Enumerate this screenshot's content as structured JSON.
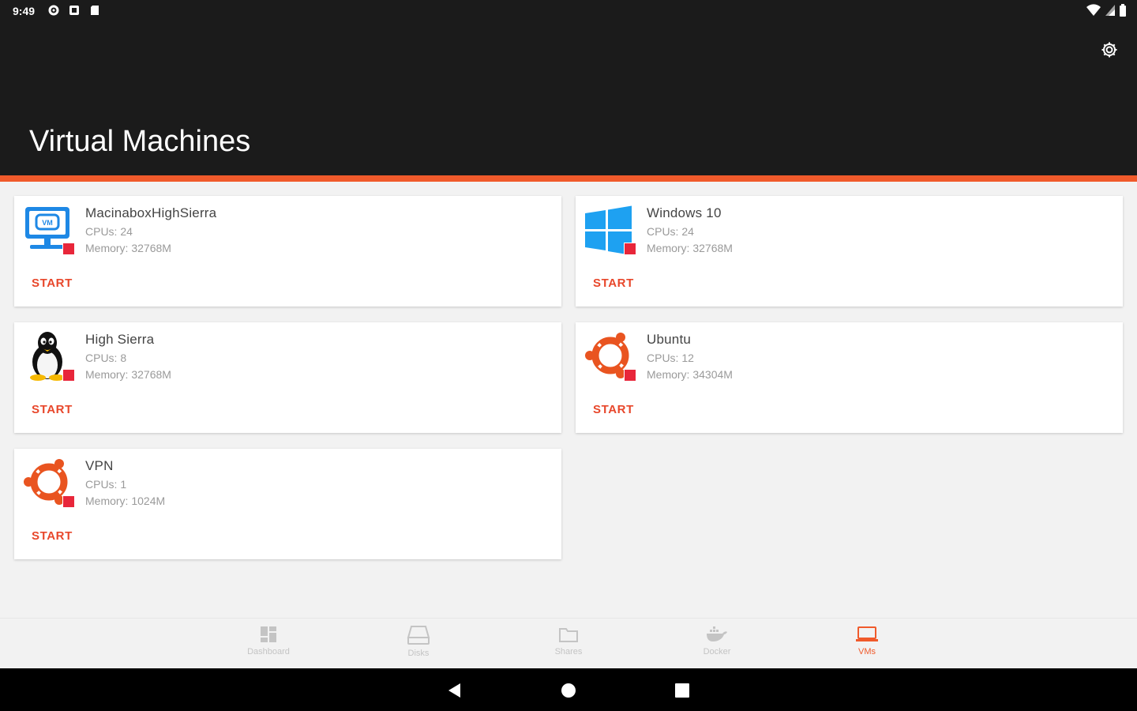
{
  "status_bar": {
    "time": "9:49"
  },
  "header": {
    "title": "Virtual Machines"
  },
  "colors": {
    "accent": "#f05a2b",
    "stopped": "#e8263a",
    "appbar": "#1b1b1b"
  },
  "vms": [
    {
      "name": "MacinaboxHighSierra",
      "cpus": "CPUs: 24",
      "memory": "Memory: 32768M",
      "icon": "monitor-vm-icon",
      "action": "START"
    },
    {
      "name": "Windows 10",
      "cpus": "CPUs: 24",
      "memory": "Memory: 32768M",
      "icon": "windows-icon",
      "action": "START"
    },
    {
      "name": "High Sierra",
      "cpus": "CPUs: 8",
      "memory": "Memory: 32768M",
      "icon": "linux-tux-icon",
      "action": "START"
    },
    {
      "name": "Ubuntu",
      "cpus": "CPUs: 12",
      "memory": "Memory: 34304M",
      "icon": "ubuntu-icon",
      "action": "START"
    },
    {
      "name": "VPN",
      "cpus": "CPUs: 1",
      "memory": "Memory: 1024M",
      "icon": "ubuntu-icon",
      "action": "START"
    }
  ],
  "bottom_nav": [
    {
      "label": "Dashboard",
      "icon": "dashboard-icon",
      "active": false
    },
    {
      "label": "Disks",
      "icon": "disk-icon",
      "active": false
    },
    {
      "label": "Shares",
      "icon": "folder-icon",
      "active": false
    },
    {
      "label": "Docker",
      "icon": "docker-icon",
      "active": false
    },
    {
      "label": "VMs",
      "icon": "laptop-icon",
      "active": true
    }
  ]
}
